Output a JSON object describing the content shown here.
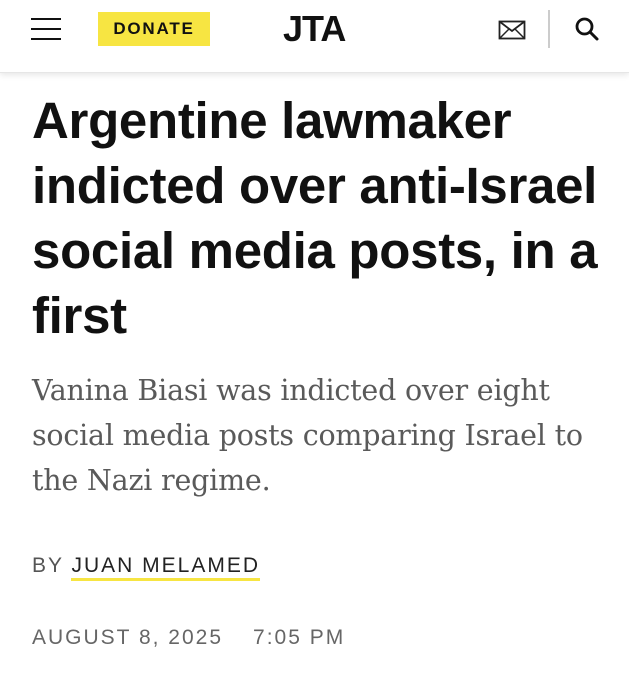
{
  "header": {
    "menu_icon": "hamburger-menu-icon",
    "donate_label": "DONATE",
    "logo_text": "JTA",
    "mail_icon": "envelope-icon",
    "search_icon": "search-icon",
    "accent_color": "#f7e542"
  },
  "article": {
    "headline": "Argentine lawmaker indicted over anti-Israel social media posts, in a first",
    "dek": "Vanina Biasi was indicted over eight social media posts comparing Israel to the Nazi regime.",
    "byline_prefix": "BY",
    "author": "JUAN MELAMED",
    "date": "AUGUST 8, 2025",
    "time": "7:05 PM"
  }
}
